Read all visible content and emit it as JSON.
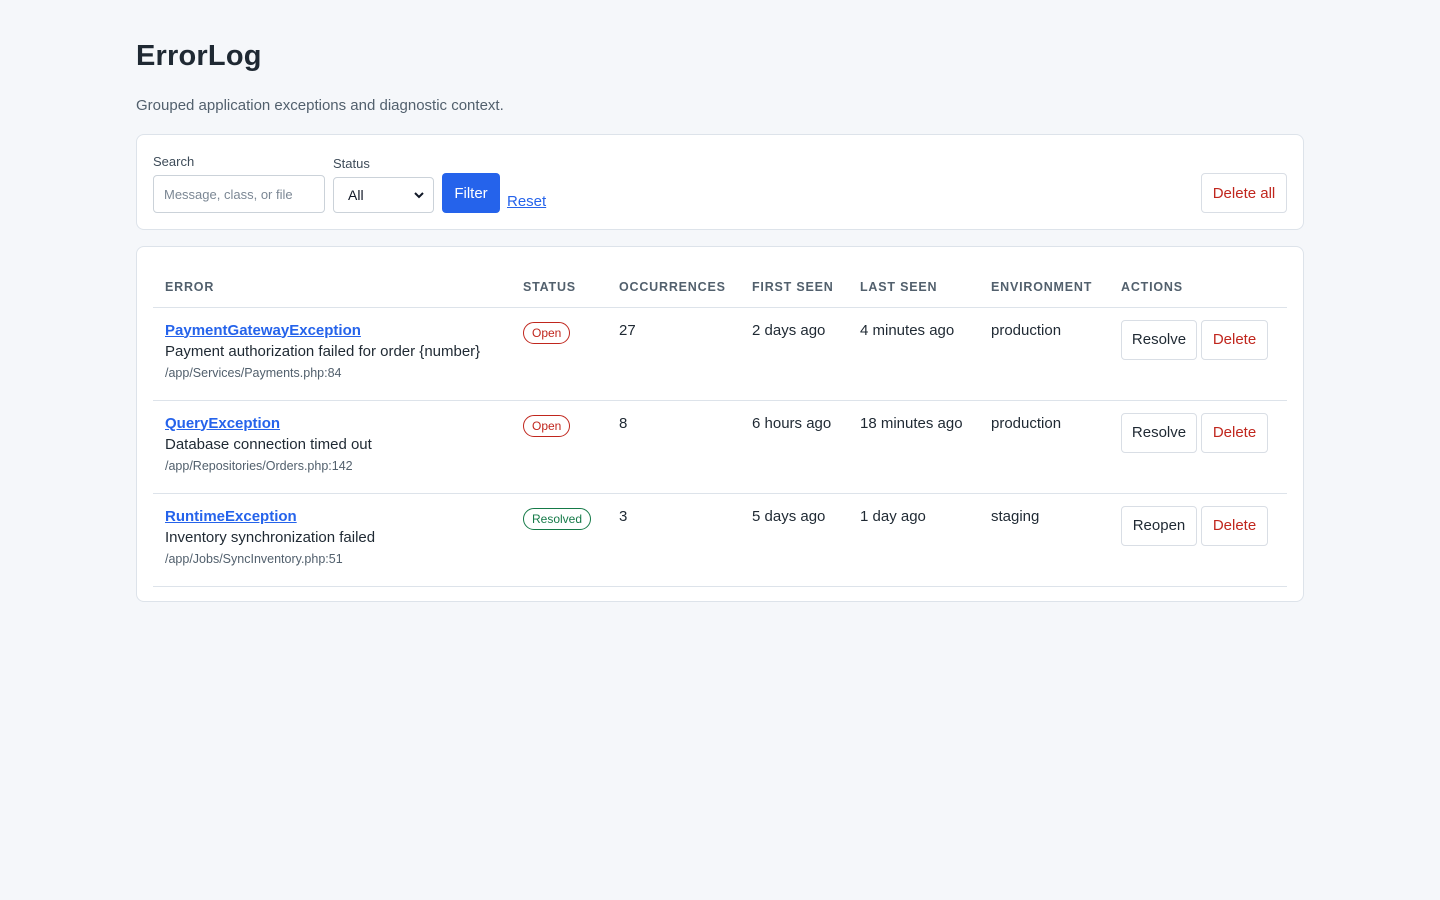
{
  "app": {
    "title": "ErrorLog",
    "subtitle": "Grouped application exceptions and diagnostic context."
  },
  "filters": {
    "search_label": "Search",
    "search_placeholder": "Message, class, or file",
    "search_value": "",
    "status_label": "Status",
    "status_value": "All",
    "filter_button": "Filter",
    "reset_link": "Reset",
    "delete_all_button": "Delete all"
  },
  "table": {
    "columns": [
      "ERROR",
      "STATUS",
      "OCCURRENCES",
      "FIRST SEEN",
      "LAST SEEN",
      "ENVIRONMENT",
      "ACTIONS"
    ],
    "rows": [
      {
        "class": "PaymentGatewayException",
        "message": "Payment authorization failed for order {number}",
        "file": "/app/Services/Payments.php:84",
        "status": "Open",
        "occurrences": "27",
        "first_seen": "2 days ago",
        "last_seen": "4 minutes ago",
        "environment": "production",
        "primary_action": "Resolve",
        "delete_action": "Delete"
      },
      {
        "class": "QueryException",
        "message": "Database connection timed out",
        "file": "/app/Repositories/Orders.php:142",
        "status": "Open",
        "occurrences": "8",
        "first_seen": "6 hours ago",
        "last_seen": "18 minutes ago",
        "environment": "production",
        "primary_action": "Resolve",
        "delete_action": "Delete"
      },
      {
        "class": "RuntimeException",
        "message": "Inventory synchronization failed",
        "file": "/app/Jobs/SyncInventory.php:51",
        "status": "Resolved",
        "occurrences": "3",
        "first_seen": "5 days ago",
        "last_seen": "1 day ago",
        "environment": "staging",
        "primary_action": "Reopen",
        "delete_action": "Delete"
      }
    ]
  },
  "colors": {
    "accent": "#2563eb",
    "danger": "#c0261d",
    "success": "#157a48",
    "background": "#f5f7fa"
  },
  "icons": {
    "select_caret": "chevron-down-icon"
  }
}
